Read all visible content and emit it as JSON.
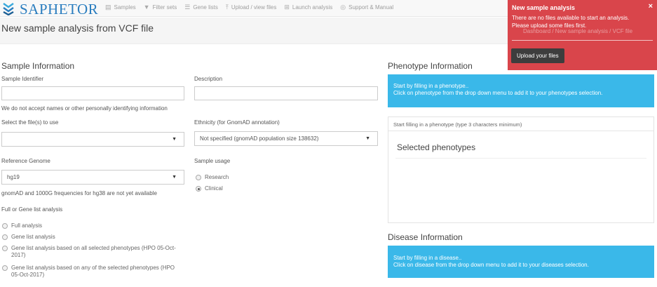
{
  "app": {
    "brand": "SAPHETOR"
  },
  "nav": {
    "items": [
      {
        "label": "Samples",
        "icon": "samples-icon"
      },
      {
        "label": "Filter sets",
        "icon": "filter-icon"
      },
      {
        "label": "Gene lists",
        "icon": "list-icon"
      },
      {
        "label": "Upload / view files",
        "icon": "upload-icon"
      },
      {
        "label": "Launch analysis",
        "icon": "plus-square-icon"
      },
      {
        "label": "Support & Manual",
        "icon": "lifebuoy-icon"
      }
    ]
  },
  "page": {
    "title": "New sample analysis from VCF file"
  },
  "sample": {
    "title": "Sample Information",
    "identifier_label": "Sample Identifier",
    "identifier_value": "",
    "description_label": "Description",
    "description_value": "",
    "privacy_note": "We do not accept names or other personally identifying information",
    "files_label": "Select the file(s) to use",
    "files_value": "",
    "ethnicity_label": "Ethnicity (for GnomAD annotation)",
    "ethnicity_value": "Not specified (gnomAD population size 138632)",
    "genome_label": "Reference Genome",
    "genome_value": "hg19",
    "genome_note": "gnomAD and 1000G frequencies for hg38 are not yet available",
    "usage_label": "Sample usage",
    "usage_options": [
      {
        "label": "Research",
        "checked": false
      },
      {
        "label": "Clinical",
        "checked": true
      }
    ],
    "analysis_label": "Full or Gene list analysis",
    "analysis_options": [
      {
        "label": "Full analysis"
      },
      {
        "label": "Gene list analysis"
      },
      {
        "label": "Gene list analysis based on all selected phenotypes (HPO 05-Oct-2017)"
      },
      {
        "label": "Gene list analysis based on any of the selected phenotypes (HPO 05-Oct-2017)"
      }
    ]
  },
  "phenotype": {
    "title": "Phenotype Information",
    "info_line1": "Start by filling in a phenotype..",
    "info_line2": "Click on phenotype from the drop down menu to add it to your phenotypes selection.",
    "input_placeholder": "Start filling in a phenotype (type 3 characters minimum)",
    "selected_title": "Selected phenotypes"
  },
  "disease": {
    "title": "Disease Information",
    "info_line1": "Start by filling in a disease..",
    "info_line2": "Click on disease from the drop down menu to add it to your diseases selection."
  },
  "toast": {
    "title": "New sample analysis",
    "message_line1": "There are no files available to start an analysis.",
    "message_line2": "Please upload some files first.",
    "ghost_text": "Dashboard / New sample analysis / VCF file",
    "button_label": "Upload your files",
    "close_glyph": "×",
    "color": "#d9454b"
  },
  "colors": {
    "brand": "#2a7dbf",
    "info": "#3ab8e9"
  }
}
